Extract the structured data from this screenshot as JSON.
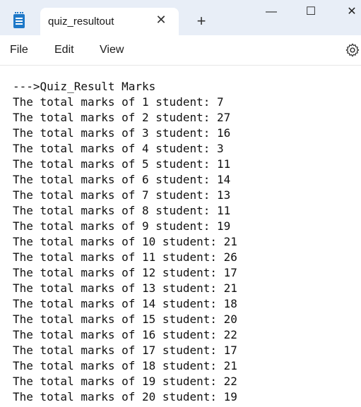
{
  "tab": {
    "title": "quiz_resultout",
    "close_glyph": "✕",
    "new_tab_glyph": "+"
  },
  "window": {
    "minimize": "—",
    "maximize": "☐",
    "close": "✕"
  },
  "menu": [
    "File",
    "Edit",
    "View"
  ],
  "icons": {
    "app": "notepad-icon",
    "settings": "gear-icon"
  },
  "colors": {
    "titlebar": "#e8eef7",
    "app_icon": "#1e78c8"
  },
  "document": {
    "lines": [
      "--->Quiz_Result Marks",
      "The total marks of 1 student: 7",
      "The total marks of 2 student: 27",
      "The total marks of 3 student: 16",
      "The total marks of 4 student: 3",
      "The total marks of 5 student: 11",
      "The total marks of 6 student: 14",
      "The total marks of 7 student: 13",
      "The total marks of 8 student: 11",
      "The total marks of 9 student: 19",
      "The total marks of 10 student: 21",
      "The total marks of 11 student: 26",
      "The total marks of 12 student: 17",
      "The total marks of 13 student: 21",
      "The total marks of 14 student: 18",
      "The total marks of 15 student: 20",
      "The total marks of 16 student: 22",
      "The total marks of 17 student: 17",
      "The total marks of 18 student: 21",
      "The total marks of 19 student: 22",
      "The total marks of 20 student: 19"
    ]
  }
}
